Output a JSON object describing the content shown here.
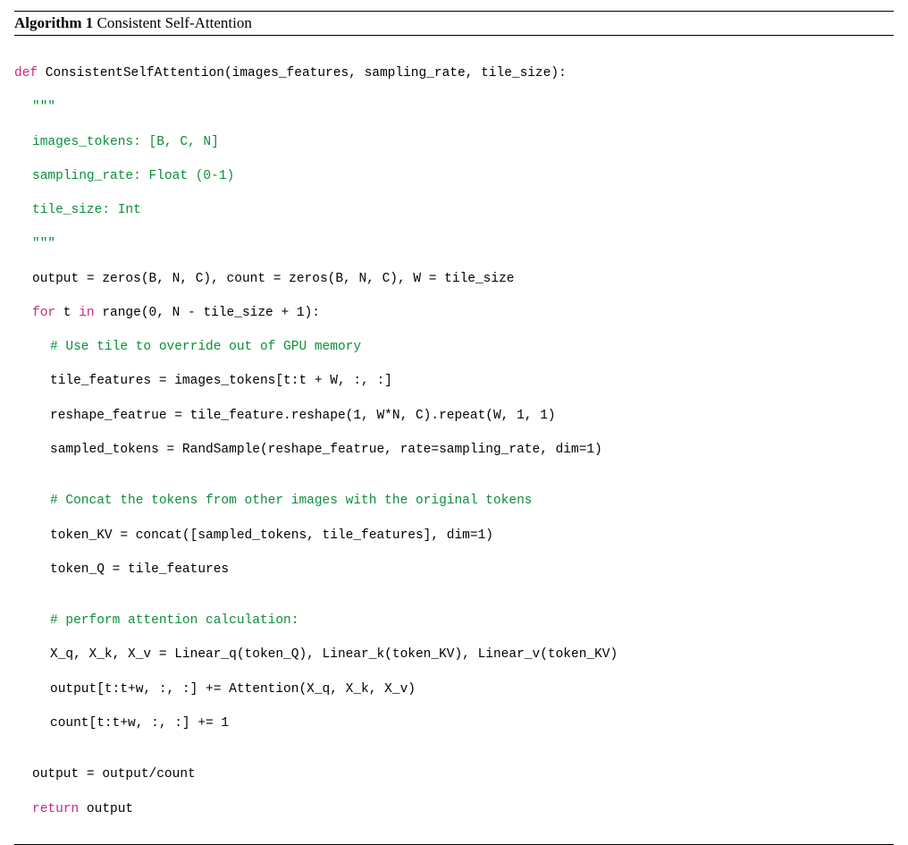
{
  "header": {
    "label": "Algorithm 1",
    "title": "Consistent Self-Attention"
  },
  "code": {
    "l01_def": "def",
    "l01_rest": " ConsistentSelfAttention(images_features, sampling_rate, tile_size):",
    "l02": "\"\"\"",
    "l03": "images_tokens: [B, C, N]",
    "l04": "sampling_rate: Float (0-1)",
    "l05": "tile_size: Int",
    "l06": "\"\"\"",
    "l07": "output = zeros(B, N, C), count = zeros(B, N, C), W = tile_size",
    "l08_for": "for",
    "l08_mid": " t ",
    "l08_in": "in",
    "l08_rest": " range(0, N - tile_size + 1):",
    "l09": "# Use tile to override out of GPU memory",
    "l10": "tile_features = images_tokens[t:t + W, :, :]",
    "l11": "reshape_featrue = tile_feature.reshape(1, W*N, C).repeat(W, 1, 1)",
    "l12": "sampled_tokens = RandSample(reshape_featrue, rate=sampling_rate, dim=1)",
    "l13": "",
    "l14": "# Concat the tokens from other images with the original tokens",
    "l15": "token_KV = concat([sampled_tokens, tile_features], dim=1)",
    "l16": "token_Q = tile_features",
    "l17": "",
    "l18": "# perform attention calculation:",
    "l19": "X_q, X_k, X_v = Linear_q(token_Q), Linear_k(token_KV), Linear_v(token_KV)",
    "l20": "output[t:t+w, :, :] += Attention(X_q, X_k, X_v)",
    "l21": "count[t:t+w, :, :] += 1",
    "l22": "",
    "l23": "output = output/count",
    "l24_ret": "return",
    "l24_rest": " output"
  }
}
